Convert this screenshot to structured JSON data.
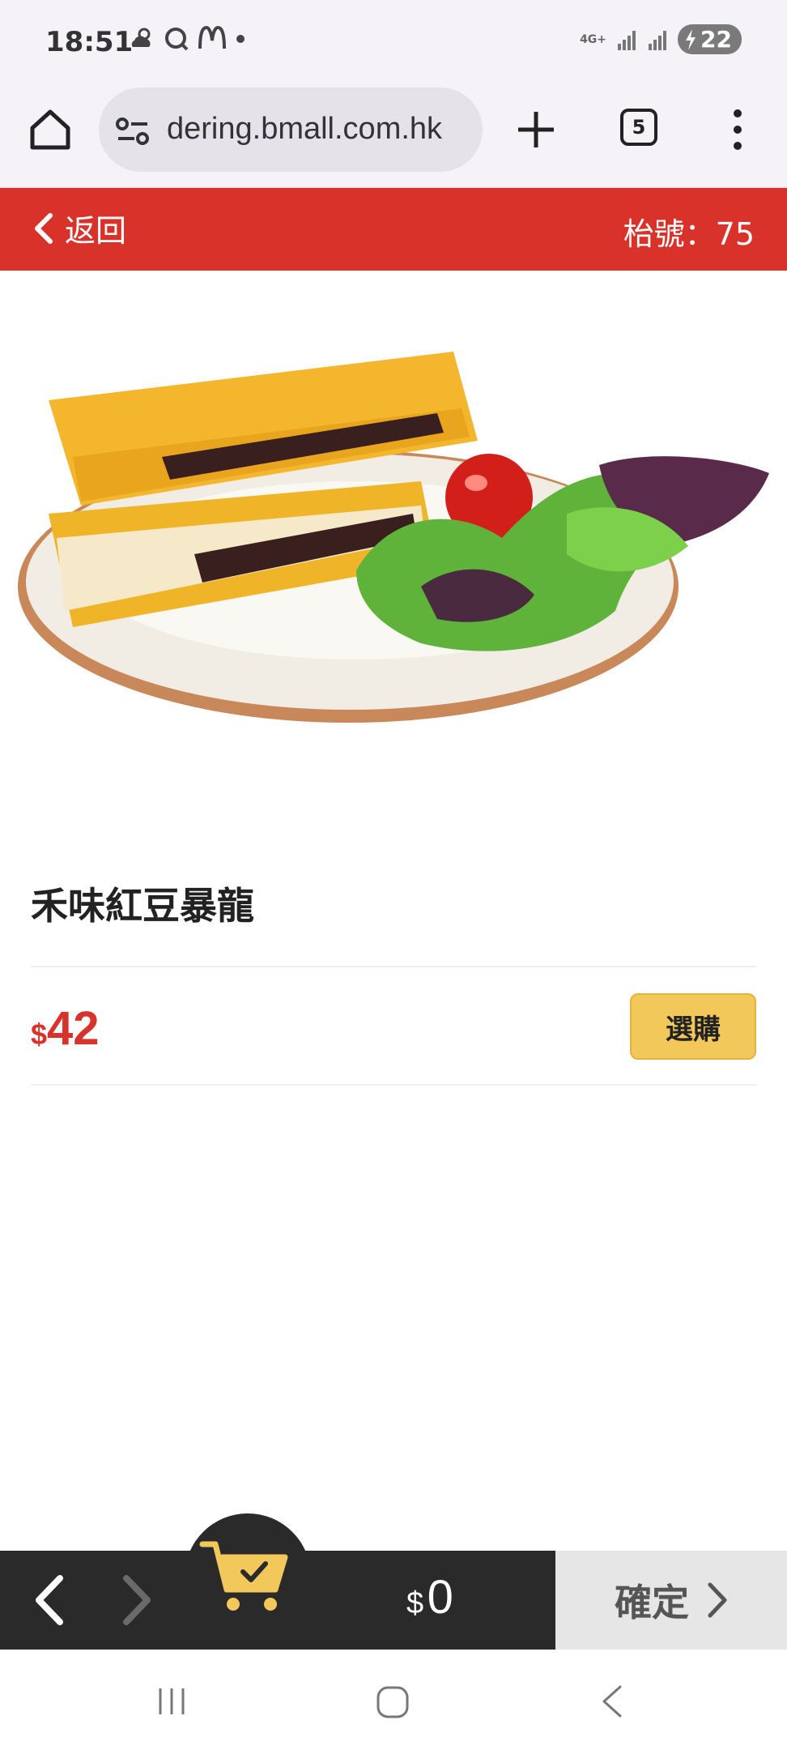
{
  "status_bar": {
    "time": "18:51",
    "left_icons": [
      "weather-icon",
      "search-app-icon",
      "mcdonalds-icon",
      "dot-icon"
    ],
    "network": "4G+",
    "battery": "22"
  },
  "browser": {
    "url": "dering.bmall.com.hk",
    "tab_count": "5"
  },
  "header": {
    "back_label": "返回",
    "table_number": "枱號：75",
    "color": "#d8322a"
  },
  "product": {
    "name": "禾味紅豆暴龍",
    "price_currency": "$",
    "price_amount": "42",
    "buy_label": "選購"
  },
  "bottom_bar": {
    "total_currency": "$",
    "total_amount": "0",
    "confirm_label": "確定",
    "accent_color": "#f3c85a"
  }
}
